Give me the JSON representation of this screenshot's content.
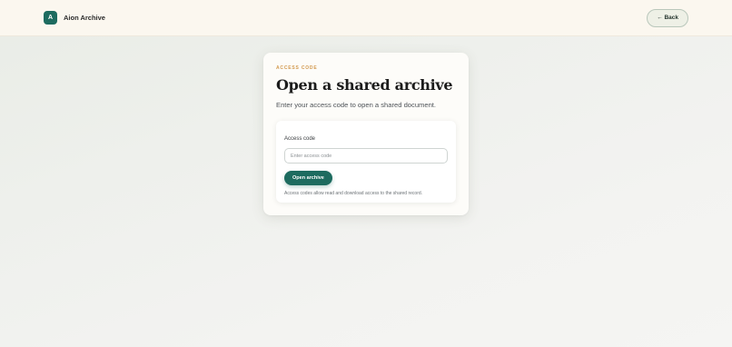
{
  "header": {
    "logo_letter": "A",
    "app_name": "Aion Archive",
    "back_label": "← Back"
  },
  "card": {
    "eyebrow": "ACCESS CODE",
    "title": "Open a shared archive",
    "subtitle": "Enter your access code to open a shared document.",
    "form": {
      "field_label": "Access code",
      "input_value": "",
      "input_placeholder": "Enter access code",
      "submit_label": "Open archive",
      "note": "Access codes allow read and download access to the shared record."
    }
  },
  "colors": {
    "accent": "#1d6b5f",
    "eyebrow": "#d39a50",
    "header_bg": "#fbf7ef"
  }
}
